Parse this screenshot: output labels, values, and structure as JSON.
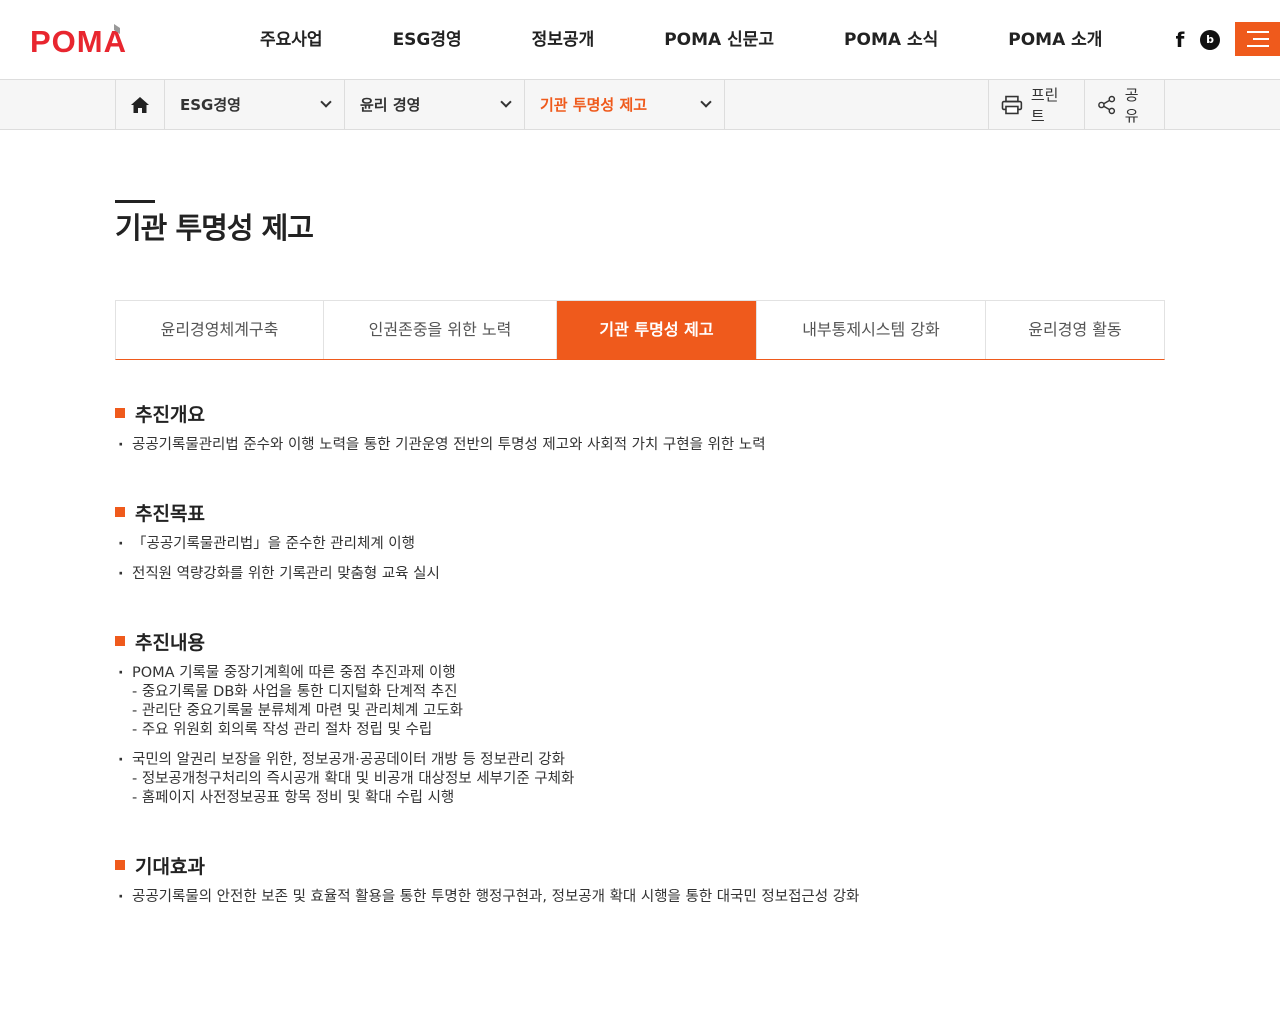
{
  "brand": {
    "logo_text": "POMA",
    "accent": "#ef5a1c"
  },
  "gnb": [
    "주요사업",
    "ESG경영",
    "정보공개",
    "POMA 신문고",
    "POMA 소식",
    "POMA 소개"
  ],
  "sns": {
    "facebook_icon": "facebook-icon",
    "blog_icon": "blog-icon"
  },
  "location": {
    "home_icon": "home-icon",
    "depth1": "ESG경영",
    "depth2": "윤리 경영",
    "depth3": "기관 투명성 제고",
    "print_label": "프린트",
    "share_label": "공유"
  },
  "page_title": "기관 투명성 제고",
  "tabs": [
    "윤리경영체계구축",
    "인권존중을 위한 노력",
    "기관 투명성 제고",
    "내부통제시스템 강화",
    "윤리경영 활동"
  ],
  "active_tab": 2,
  "sections": [
    {
      "title": "추진개요",
      "items": [
        {
          "text": "공공기록물관리법 준수와 이행 노력을 통한 기관운영 전반의 투명성 제고와 사회적 가치 구현을 위한 노력",
          "subs": []
        }
      ]
    },
    {
      "title": "추진목표",
      "items": [
        {
          "text": "「공공기록물관리법」을 준수한 관리체계 이행",
          "subs": []
        },
        {
          "text": "전직원 역량강화를 위한 기록관리 맞춤형 교육 실시",
          "subs": []
        }
      ]
    },
    {
      "title": "추진내용",
      "items": [
        {
          "text": "POMA 기록물 중장기계획에 따른 중점 추진과제 이행",
          "subs": [
            "- 중요기록물 DB화 사업을 통한 디지털화 단계적 추진",
            "- 관리단 중요기록물 분류체계 마련 및 관리체계 고도화",
            "- 주요 위원회 회의록 작성 관리 절차 정립 및 수립"
          ]
        },
        {
          "text": "국민의 알권리 보장을 위한, 정보공개·공공데이터 개방 등 정보관리 강화",
          "subs": [
            "- 정보공개청구처리의 즉시공개 확대 및 비공개 대상정보 세부기준 구체화",
            "- 홈페이지 사전정보공표 항목 정비 및 확대 수립 시행"
          ]
        }
      ]
    },
    {
      "title": "기대효과",
      "items": [
        {
          "text": "공공기록물의 안전한 보존 및 효율적 활용을 통한 투명한 행정구현과, 정보공개 확대 시행을 통한 대국민 정보접근성 강화",
          "subs": []
        }
      ]
    }
  ]
}
